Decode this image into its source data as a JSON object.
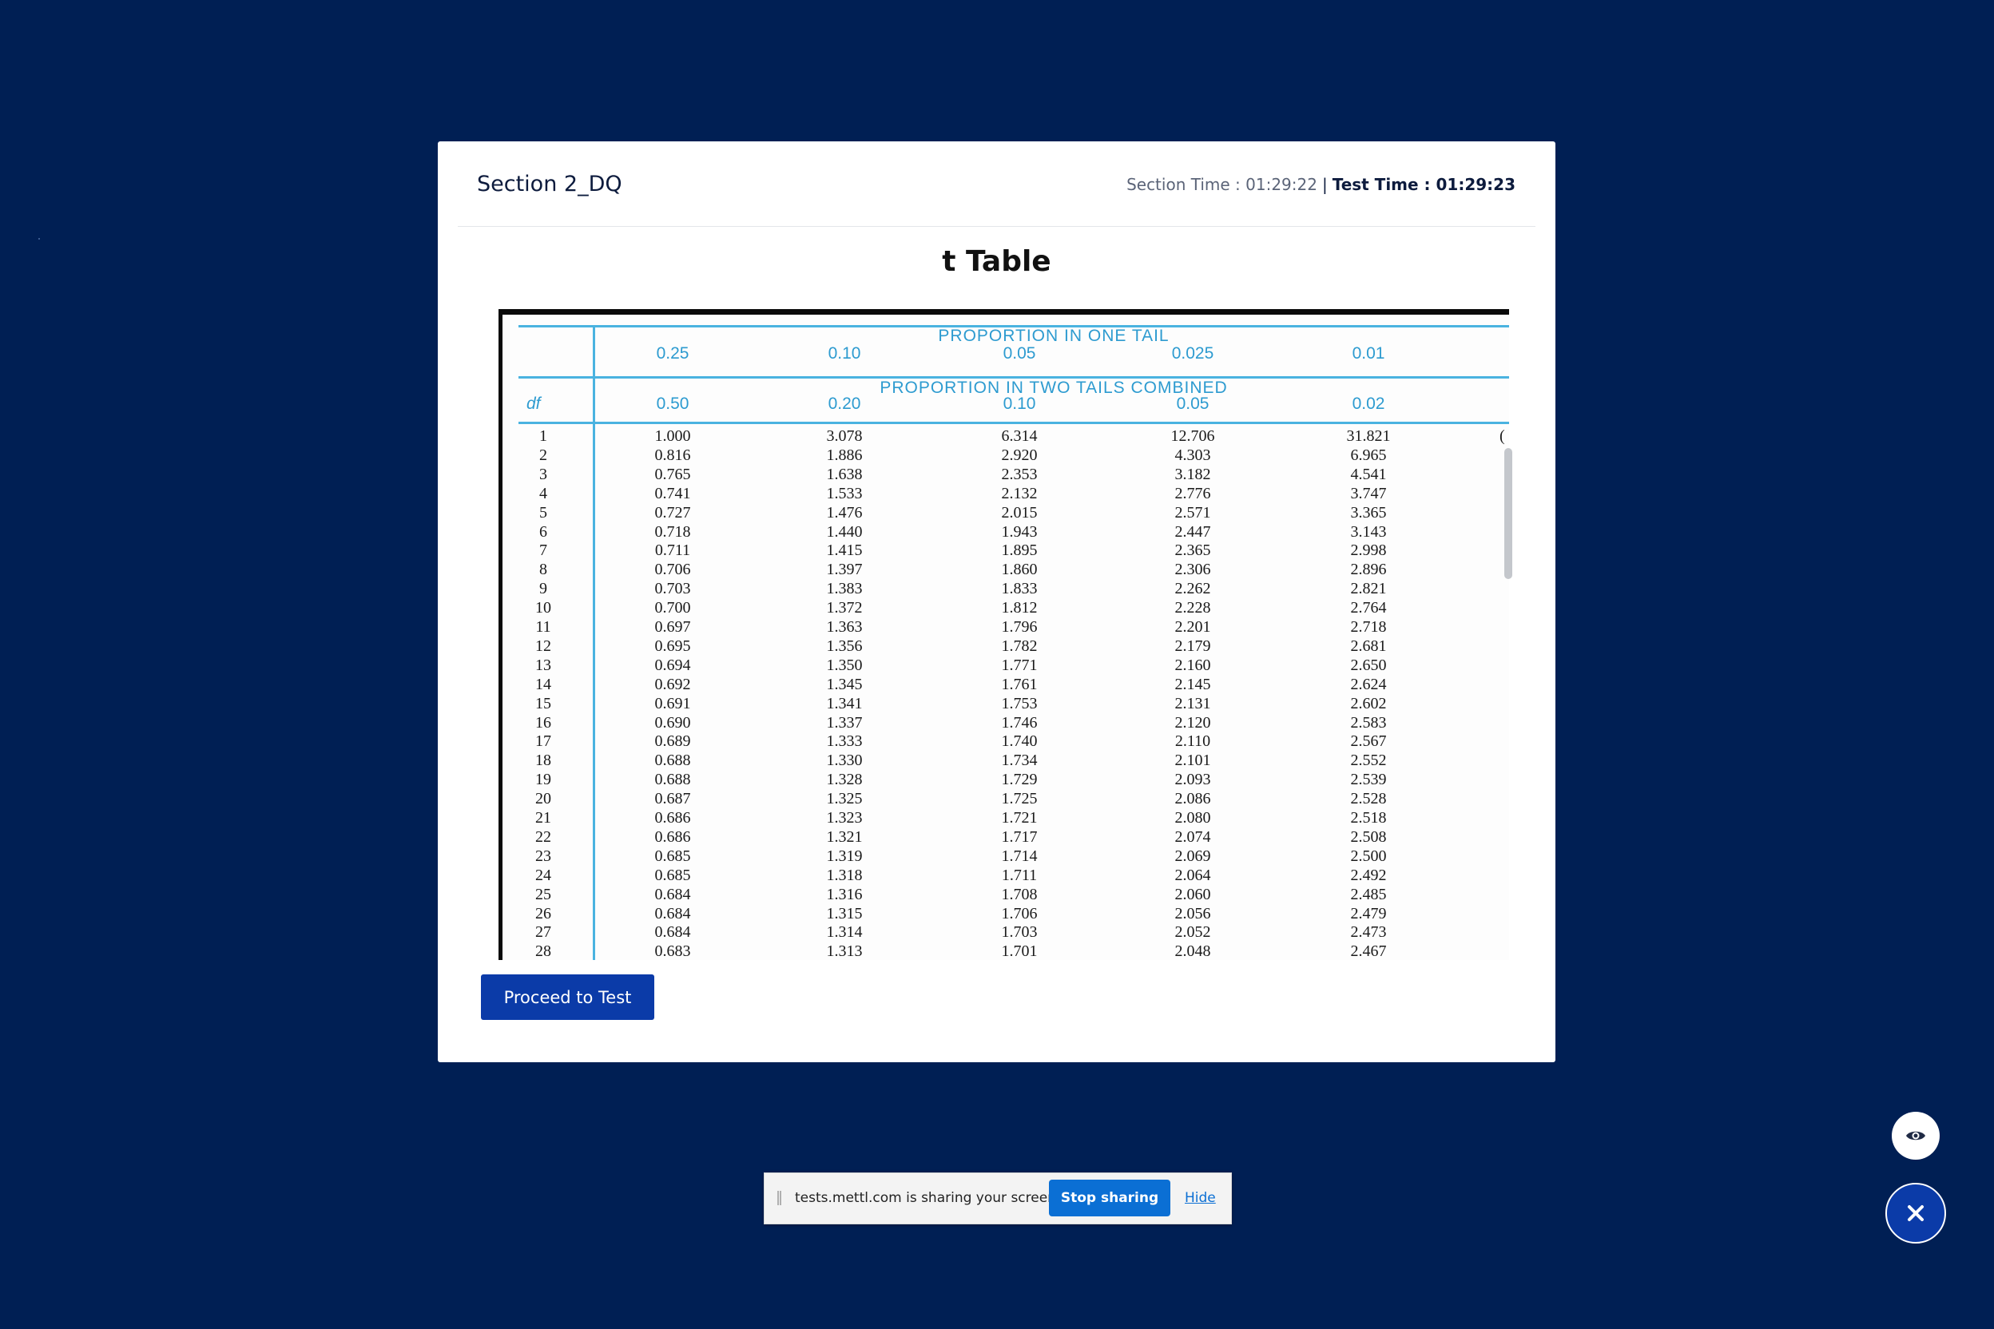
{
  "header": {
    "section_title": "Section 2_DQ",
    "section_time_label": "Section Time : 01:29:22",
    "separator": "|",
    "test_time_label": "Test Time : 01:29:23"
  },
  "content": {
    "table_title": "t Table"
  },
  "t_table": {
    "one_tail_caption": "PROPORTION IN ONE TAIL",
    "two_tail_caption": "PROPORTION IN TWO TAILS COMBINED",
    "df_label": "df",
    "one_tail_headers": [
      "0.25",
      "0.10",
      "0.05",
      "0.025",
      "0.01"
    ],
    "two_tail_headers": [
      "0.50",
      "0.20",
      "0.10",
      "0.05",
      "0.02"
    ],
    "rows": [
      [
        "1",
        "1.000",
        "3.078",
        "6.314",
        "12.706",
        "31.821"
      ],
      [
        "2",
        "0.816",
        "1.886",
        "2.920",
        "4.303",
        "6.965"
      ],
      [
        "3",
        "0.765",
        "1.638",
        "2.353",
        "3.182",
        "4.541"
      ],
      [
        "4",
        "0.741",
        "1.533",
        "2.132",
        "2.776",
        "3.747"
      ],
      [
        "5",
        "0.727",
        "1.476",
        "2.015",
        "2.571",
        "3.365"
      ],
      [
        "6",
        "0.718",
        "1.440",
        "1.943",
        "2.447",
        "3.143"
      ],
      [
        "7",
        "0.711",
        "1.415",
        "1.895",
        "2.365",
        "2.998"
      ],
      [
        "8",
        "0.706",
        "1.397",
        "1.860",
        "2.306",
        "2.896"
      ],
      [
        "9",
        "0.703",
        "1.383",
        "1.833",
        "2.262",
        "2.821"
      ],
      [
        "10",
        "0.700",
        "1.372",
        "1.812",
        "2.228",
        "2.764"
      ],
      [
        "11",
        "0.697",
        "1.363",
        "1.796",
        "2.201",
        "2.718"
      ],
      [
        "12",
        "0.695",
        "1.356",
        "1.782",
        "2.179",
        "2.681"
      ],
      [
        "13",
        "0.694",
        "1.350",
        "1.771",
        "2.160",
        "2.650"
      ],
      [
        "14",
        "0.692",
        "1.345",
        "1.761",
        "2.145",
        "2.624"
      ],
      [
        "15",
        "0.691",
        "1.341",
        "1.753",
        "2.131",
        "2.602"
      ],
      [
        "16",
        "0.690",
        "1.337",
        "1.746",
        "2.120",
        "2.583"
      ],
      [
        "17",
        "0.689",
        "1.333",
        "1.740",
        "2.110",
        "2.567"
      ],
      [
        "18",
        "0.688",
        "1.330",
        "1.734",
        "2.101",
        "2.552"
      ],
      [
        "19",
        "0.688",
        "1.328",
        "1.729",
        "2.093",
        "2.539"
      ],
      [
        "20",
        "0.687",
        "1.325",
        "1.725",
        "2.086",
        "2.528"
      ],
      [
        "21",
        "0.686",
        "1.323",
        "1.721",
        "2.080",
        "2.518"
      ],
      [
        "22",
        "0.686",
        "1.321",
        "1.717",
        "2.074",
        "2.508"
      ],
      [
        "23",
        "0.685",
        "1.319",
        "1.714",
        "2.069",
        "2.500"
      ],
      [
        "24",
        "0.685",
        "1.318",
        "1.711",
        "2.064",
        "2.492"
      ],
      [
        "25",
        "0.684",
        "1.316",
        "1.708",
        "2.060",
        "2.485"
      ],
      [
        "26",
        "0.684",
        "1.315",
        "1.706",
        "2.056",
        "2.479"
      ],
      [
        "27",
        "0.684",
        "1.314",
        "1.703",
        "2.052",
        "2.473"
      ],
      [
        "28",
        "0.683",
        "1.313",
        "1.701",
        "2.048",
        "2.467"
      ]
    ]
  },
  "actions": {
    "proceed_label": "Proceed to Test"
  },
  "share_bar": {
    "message": "tests.mettl.com is sharing your screen.",
    "stop_label": "Stop sharing",
    "hide_label": "Hide"
  },
  "floating": {
    "eye_icon": "eye-icon",
    "close_icon": "close-icon"
  },
  "colors": {
    "background": "#001f54",
    "primary_button": "#0b3ba8",
    "table_accent": "#4ab3e0",
    "share_button": "#0b6fd4"
  }
}
